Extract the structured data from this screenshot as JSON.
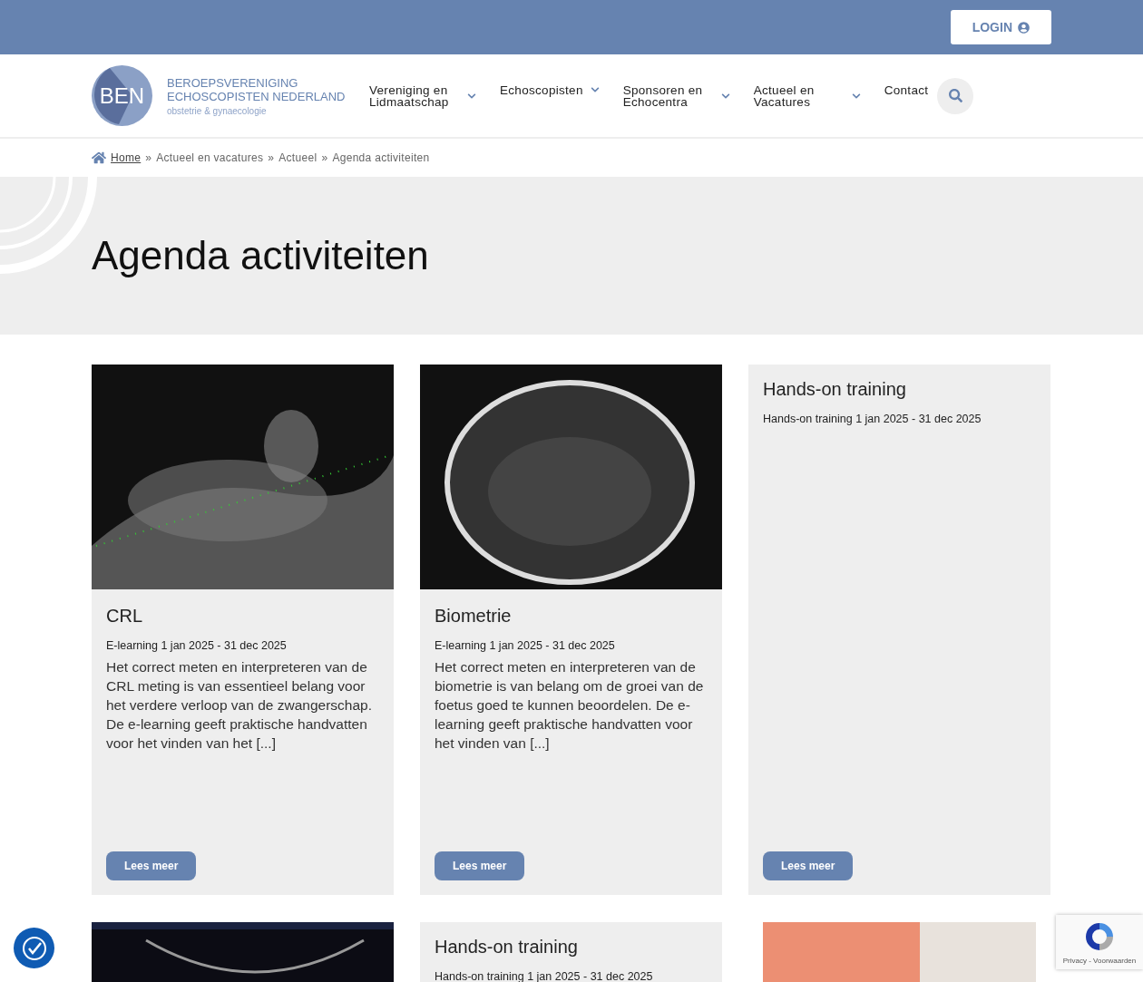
{
  "top_bar": {
    "login_button": "LOGIN"
  },
  "logo": {
    "initials": "BEN",
    "line_1": "BEROEPSVERENIGING",
    "line_2": "ECHOSCOPISTEN NEDERLAND",
    "tagline": "obstetrie & gynaecologie"
  },
  "nav": {
    "items": [
      {
        "label": "Vereniging en Lidmaatschap",
        "has_dropdown": true
      },
      {
        "label": "Echoscopisten",
        "has_dropdown": true
      },
      {
        "label": "Sponsoren en Echocentra",
        "has_dropdown": true
      },
      {
        "label": "Actueel en Vacatures",
        "has_dropdown": true
      },
      {
        "label": "Contact",
        "has_dropdown": false
      }
    ]
  },
  "breadcrumb": {
    "separator": "»",
    "items": [
      {
        "label": "Home",
        "link": true
      },
      {
        "label": "Actueel en vacatures",
        "link": false
      },
      {
        "label": "Actueel",
        "link": false
      },
      {
        "label": "Agenda activiteiten",
        "link": false
      }
    ]
  },
  "hero": {
    "title": "Agenda activiteiten"
  },
  "cards": [
    {
      "kind": "image_article",
      "title": "CRL",
      "meta": "E-learning 1 jan 2025 - 31 dec 2025",
      "excerpt": "Het correct meten en interpreteren van de CRL meting is van essentieel belang voor het verdere verloop van de zwangerschap. De e-learning geeft praktische handvatten voor het vinden van het [...]",
      "button": "Lees meer"
    },
    {
      "kind": "image_article",
      "title": "Biometrie",
      "meta": "E-learning 1 jan 2025 - 31 dec 2025",
      "excerpt": "Het correct meten en interpreteren van de biometrie is van belang om de groei van de foetus goed te kunnen beoordelen. De e-learning geeft praktische handvatten voor het vinden van [...]",
      "button": "Lees meer"
    },
    {
      "kind": "text_article",
      "title": "Hands-on training",
      "meta": "Hands-on training 1 jan 2025 - 31 dec 2025",
      "button": "Lees meer"
    },
    {
      "kind": "photo"
    },
    {
      "kind": "text_article",
      "title": "Hands-on training",
      "meta": "Hands-on training 1 jan 2025 - 31 dec 2025"
    },
    {
      "kind": "promo"
    }
  ],
  "recaptcha": {
    "links": "Privacy - Voorwaarden"
  }
}
